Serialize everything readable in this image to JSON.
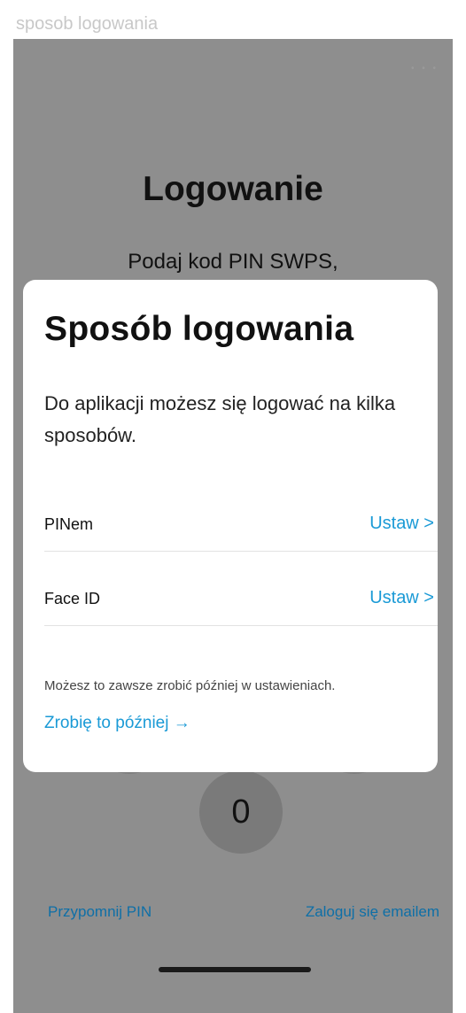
{
  "caption": "sposob logowania",
  "background_screen": {
    "title": "Logowanie",
    "subtitle": "Podaj kod PIN SWPS,",
    "keypad_zero": "0",
    "left_link": "Przypomnij PIN",
    "right_link": "Zaloguj się emailem"
  },
  "sheet": {
    "title": "Sposób logowania",
    "description": "Do aplikacji możesz się logować na kilka sposobów.",
    "options": [
      {
        "label": "PINem",
        "action": "Ustaw >"
      },
      {
        "label": "Face ID",
        "action": "Ustaw >"
      }
    ],
    "note": "Możesz to zawsze zrobić później w ustawieniach.",
    "later_link": "Zrobię to później →"
  },
  "colors": {
    "accent": "#1a9ad6",
    "overlay": "#8e8e8e",
    "bottom_link": "#0e6fa7"
  }
}
